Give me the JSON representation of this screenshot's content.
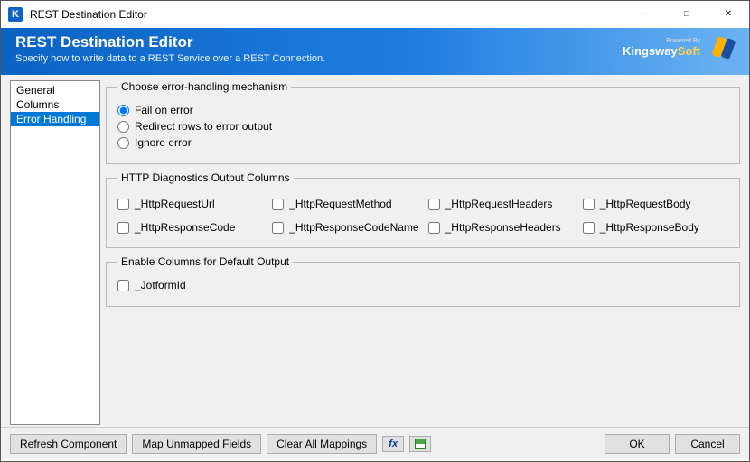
{
  "window": {
    "title": "REST Destination Editor"
  },
  "banner": {
    "title": "REST Destination Editor",
    "subtitle": "Specify how to write data to a REST Service over a REST Connection.",
    "poweredBy": "Powered By",
    "brandPart1": "Kingsway",
    "brandPart2": "Soft"
  },
  "sidebar": {
    "items": [
      {
        "label": "General",
        "selected": false
      },
      {
        "label": "Columns",
        "selected": false
      },
      {
        "label": "Error Handling",
        "selected": true
      }
    ]
  },
  "errorHandling": {
    "legend": "Choose error-handling mechanism",
    "options": [
      {
        "label": "Fail on error",
        "checked": true
      },
      {
        "label": "Redirect rows to error output",
        "checked": false
      },
      {
        "label": "Ignore error",
        "checked": false
      }
    ]
  },
  "httpDiag": {
    "legend": "HTTP Diagnostics Output Columns",
    "cols": [
      {
        "label": "_HttpRequestUrl",
        "checked": false
      },
      {
        "label": "_HttpRequestMethod",
        "checked": false
      },
      {
        "label": "_HttpRequestHeaders",
        "checked": false
      },
      {
        "label": "_HttpRequestBody",
        "checked": false
      },
      {
        "label": "_HttpResponseCode",
        "checked": false
      },
      {
        "label": "_HttpResponseCodeName",
        "checked": false
      },
      {
        "label": "_HttpResponseHeaders",
        "checked": false
      },
      {
        "label": "_HttpResponseBody",
        "checked": false
      }
    ]
  },
  "defaultOutput": {
    "legend": "Enable Columns for Default Output",
    "cols": [
      {
        "label": "_JotformId",
        "checked": false
      }
    ]
  },
  "footer": {
    "refresh": "Refresh Component",
    "mapUnmapped": "Map Unmapped Fields",
    "clearAll": "Clear All Mappings",
    "ok": "OK",
    "cancel": "Cancel"
  }
}
